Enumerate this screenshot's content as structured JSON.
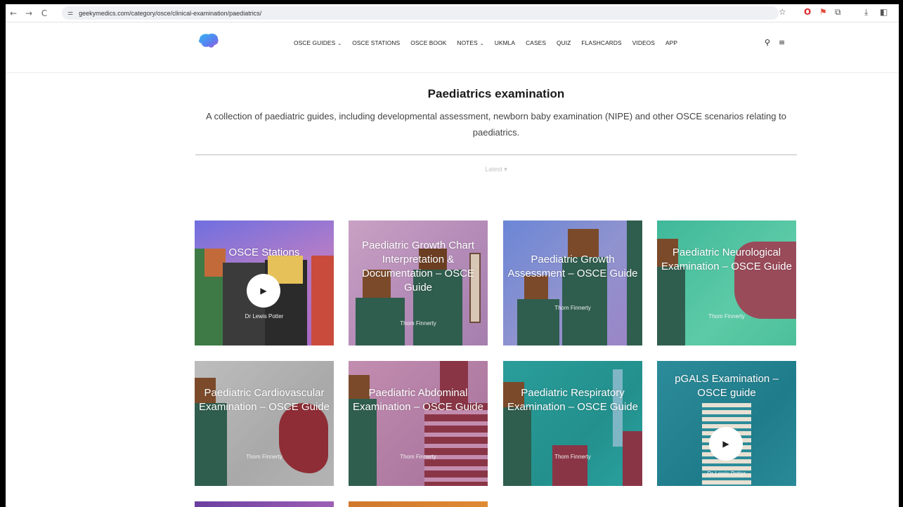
{
  "browser": {
    "url": "geekymedics.com/category/osce/clinical-examination/paediatrics/",
    "back": "←",
    "forward": "→",
    "reload": "C"
  },
  "nav": {
    "items": [
      {
        "label": "OSCE GUIDES",
        "dropdown": true
      },
      {
        "label": "OSCE STATIONS",
        "dropdown": false
      },
      {
        "label": "OSCE BOOK",
        "dropdown": false
      },
      {
        "label": "NOTES",
        "dropdown": true
      },
      {
        "label": "UKMLA",
        "dropdown": false
      },
      {
        "label": "CASES",
        "dropdown": false
      },
      {
        "label": "QUIZ",
        "dropdown": false
      },
      {
        "label": "FLASHCARDS",
        "dropdown": false
      },
      {
        "label": "VIDEOS",
        "dropdown": false
      },
      {
        "label": "APP",
        "dropdown": false
      }
    ]
  },
  "page": {
    "title": "Paediatrics examination",
    "description": "A collection of paediatric guides, including developmental assessment, newborn baby examination (NIPE) and other OSCE scenarios relating to paediatrics.",
    "sort_label": "Latest ▾"
  },
  "cards": [
    {
      "title": "OSCE Stations",
      "author": "Dr Lewis Potter",
      "video": true,
      "bg": "#8a6cc0"
    },
    {
      "title": "Paediatric Growth Chart Interpretation & Documentation – OSCE Guide",
      "author": "Thom Finnerty",
      "video": false,
      "bg": "#b993b8"
    },
    {
      "title": "Paediatric Growth Assessment – OSCE Guide",
      "author": "Thom Finnerty",
      "video": false,
      "bg": "#7f8fc9"
    },
    {
      "title": "Paediatric Neurological Examination – OSCE Guide",
      "author": "Thom Finnerty",
      "video": false,
      "bg": "#4fbf9f"
    },
    {
      "title": "Paediatric Cardiovascular Examination – OSCE Guide",
      "author": "Thom Finnerty",
      "video": false,
      "bg": "#b7b7b7"
    },
    {
      "title": "Paediatric Abdominal Examination – OSCE Guide",
      "author": "Thom Finnerty",
      "video": false,
      "bg": "#b98aa8"
    },
    {
      "title": "Paediatric Respiratory Examination – OSCE Guide",
      "author": "Thom Finnerty",
      "video": false,
      "bg": "#2a9d9a"
    },
    {
      "title": "pGALS Examination – OSCE guide",
      "author": "Dr Lewis Potter",
      "video": true,
      "bg": "#2d8c9a"
    }
  ],
  "colors": {
    "accent": "#3a8fe6",
    "card_text": "#ffffff"
  }
}
